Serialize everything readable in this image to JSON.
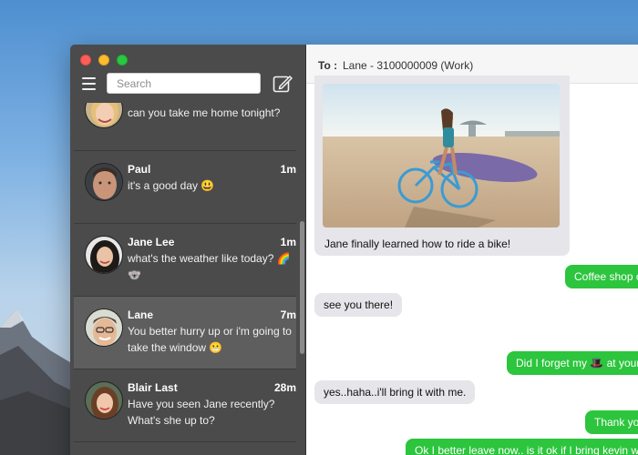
{
  "search": {
    "placeholder": "Search"
  },
  "conversations": [
    {
      "name": "",
      "time": "",
      "preview": "can you take me home tonight?"
    },
    {
      "name": "Paul",
      "time": "1m",
      "preview": "it's a good day 😃"
    },
    {
      "name": "Jane Lee",
      "time": "1m",
      "preview": "what's the weather like today? 🌈🐨"
    },
    {
      "name": "Lane",
      "time": "7m",
      "preview": "You better hurry up or i'm going to take the window 😬"
    },
    {
      "name": "Blair Last",
      "time": "28m",
      "preview": "Have you seen Jane recently? What's she up to?"
    }
  ],
  "chat": {
    "to_label": "To :",
    "to_value": "Lane - 3100000009 (Work)",
    "messages": [
      {
        "dir": "in",
        "text": "Jane finally learned how to ride a bike!"
      },
      {
        "dir": "out",
        "text": "Coffee shop on"
      },
      {
        "dir": "in",
        "text": "see you there!"
      },
      {
        "dir": "out",
        "text": "Did I forget my 🎩 at your"
      },
      {
        "dir": "in",
        "text": "yes..haha..i'll bring it with me."
      },
      {
        "dir": "out",
        "text": "Thank you"
      },
      {
        "dir": "out",
        "text": "Ok I better leave now.. is it ok if I bring kevin with"
      }
    ]
  },
  "colors": {
    "sidebar": "#4b4b4b",
    "active_row": "#5e5e5e",
    "outgoing": "#2cc53d",
    "incoming": "#e5e5ea"
  }
}
